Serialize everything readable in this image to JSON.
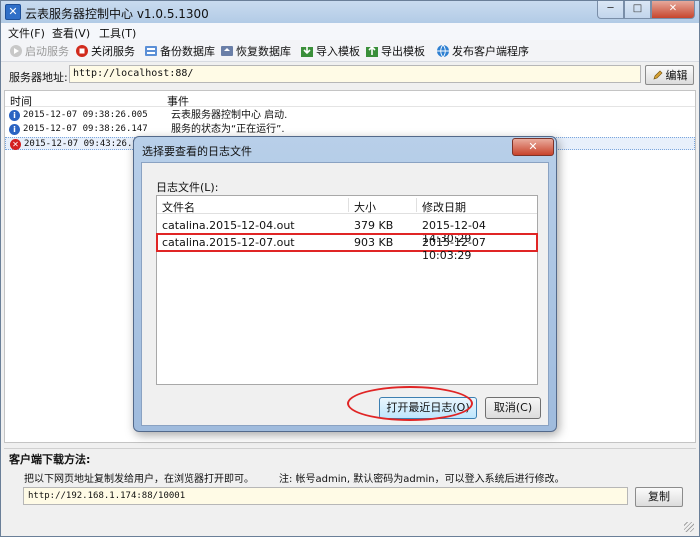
{
  "window": {
    "title": "云表服务器控制中心 v1.0.5.1300",
    "controls": {
      "minimize": "─",
      "maximize": "□",
      "close": "✕"
    }
  },
  "menu": [
    {
      "label": "文件(F)"
    },
    {
      "label": "查看(V)"
    },
    {
      "label": "工具(T)"
    }
  ],
  "toolbar": {
    "start_service": "启动服务",
    "stop_service": "关闭服务",
    "backup_db": "备份数据库",
    "restore_db": "恢复数据库",
    "import_template": "导入模板",
    "export_template": "导出模板",
    "publish_client": "发布客户端程序"
  },
  "server": {
    "address_label": "服务器地址:",
    "address_value": "http://localhost:88/",
    "edit_label": "编辑"
  },
  "log": {
    "columns": {
      "time": "时间",
      "event": "事件"
    },
    "rows": [
      {
        "time": "2015-12-07 09:38:26.005",
        "event": "云表服务器控制中心 启动.",
        "level": "info"
      },
      {
        "time": "2015-12-07 09:38:26.147",
        "event": "服务的状态为“正在运行”.",
        "level": "info"
      },
      {
        "time": "2015-12-07 09:43:26.98",
        "event": "",
        "level": "error"
      }
    ]
  },
  "download": {
    "title": "客户端下载方法:",
    "description": "把以下网页地址复制发给用户，在浏览器打开即可。",
    "note": "注: 帐号admin, 默认密码为admin，可以登入系统后进行修改。",
    "url": "http://192.168.1.174:88/10001",
    "copy_label": "复制"
  },
  "dialog": {
    "title": "选择要查看的日志文件",
    "close": "✕",
    "list_label": "日志文件(L):",
    "columns": {
      "name": "文件名",
      "size": "大小",
      "date": "修改日期"
    },
    "files": [
      {
        "name": "catalina.2015-12-04.out",
        "size": "379 KB",
        "date": "2015-12-04 14:30:29"
      },
      {
        "name": "catalina.2015-12-07.out",
        "size": "903 KB",
        "date": "2015-12-07 10:03:29"
      }
    ],
    "open_label": "打开最近日志(O)",
    "cancel_label": "取消(C)"
  },
  "colors": {
    "highlight_annotation": "#e02525",
    "address_field_bg": "#fffbe6",
    "titlebar": "#b2cbe6"
  }
}
